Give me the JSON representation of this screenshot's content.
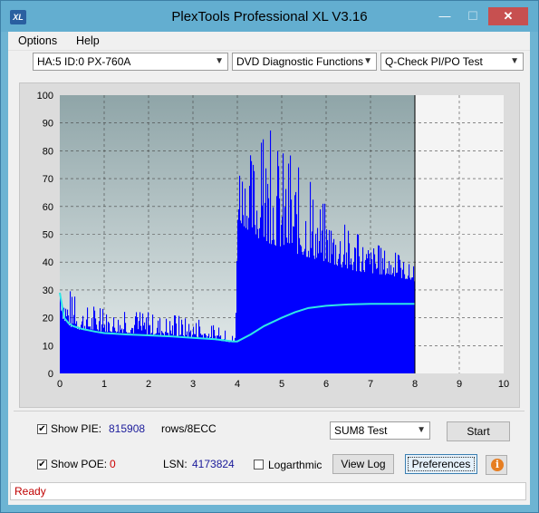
{
  "window": {
    "title": "PlexTools Professional XL V3.16",
    "app_icon_text": "XL",
    "minimize_glyph": "—",
    "maximize_glyph": "☐",
    "close_glyph": "✕"
  },
  "menu": {
    "items": [
      "Options",
      "Help"
    ]
  },
  "toolbar": {
    "drive": "HA:5 ID:0  PX-760A",
    "function": "DVD Diagnostic Functions",
    "test": "Q-Check PI/PO Test"
  },
  "chart_data": {
    "type": "area",
    "xlim": [
      0,
      10
    ],
    "ylim": [
      0,
      100
    ],
    "x_ticks": [
      "0",
      "1",
      "2",
      "3",
      "4",
      "5",
      "6",
      "7",
      "8",
      "9",
      "10"
    ],
    "y_ticks": [
      "0",
      "10",
      "20",
      "30",
      "40",
      "50",
      "60",
      "70",
      "80",
      "90",
      "100"
    ],
    "grid": true,
    "data_end_x": 8,
    "series": [
      {
        "kind": "pie_bars",
        "color": "#0000ff",
        "envelope_x": [
          0.0,
          0.05,
          0.1,
          0.2,
          0.3,
          0.5,
          1.0,
          1.5,
          2.0,
          2.5,
          3.0,
          3.5,
          3.9,
          3.95,
          4.0,
          4.2,
          4.5,
          4.7,
          5.0,
          5.5,
          6.0,
          6.5,
          7.0,
          7.5,
          8.0
        ],
        "envelope_y": [
          46,
          38,
          32,
          30,
          28,
          25,
          23,
          22,
          22,
          21,
          20,
          17,
          14,
          14,
          84,
          80,
          82,
          88,
          82,
          72,
          60,
          52,
          47,
          44,
          38
        ],
        "base_x": [
          0.0,
          0.05,
          0.1,
          0.2,
          0.3,
          0.5,
          1.0,
          1.5,
          2.0,
          2.5,
          3.0,
          3.5,
          3.9,
          3.95,
          4.0,
          4.2,
          4.5,
          5.0,
          5.5,
          6.0,
          6.5,
          7.0,
          7.5,
          8.0
        ],
        "base_y": [
          24,
          20,
          18,
          17,
          16,
          15.5,
          15,
          14.5,
          14,
          13.5,
          13,
          12,
          11,
          11,
          55,
          52,
          48,
          45,
          42,
          40,
          37,
          36,
          35,
          33
        ]
      },
      {
        "kind": "line",
        "color": "#2ee6e6",
        "x": [
          0.0,
          0.1,
          0.2,
          0.3,
          0.5,
          0.8,
          1.0,
          1.5,
          2.0,
          2.5,
          3.0,
          3.5,
          3.9,
          4.0,
          4.3,
          4.6,
          5.0,
          5.3,
          5.6,
          6.0,
          6.5,
          7.0,
          7.5,
          8.0
        ],
        "y": [
          29,
          20,
          18,
          17,
          16,
          15,
          14.5,
          14,
          13.7,
          13.3,
          12.8,
          12.3,
          11.5,
          11.5,
          14,
          17,
          20,
          22,
          23.5,
          24.3,
          24.8,
          25,
          25,
          25
        ]
      }
    ]
  },
  "pie": {
    "checked": true,
    "label": "Show PIE:",
    "value": "815908",
    "unit": "rows/8ECC"
  },
  "poe": {
    "checked": true,
    "label": "Show POE:",
    "value": "0",
    "lsn_label": "LSN:",
    "lsn_value": "4173824",
    "log_checked": false,
    "log_label": "Logarthmic"
  },
  "controls": {
    "test_select": "SUM8 Test",
    "start_label": "Start",
    "view_log_label": "View Log",
    "preferences_label": "Preferences",
    "info_glyph": "i",
    "check_glyph": "✔"
  },
  "status": {
    "text": "Ready"
  }
}
